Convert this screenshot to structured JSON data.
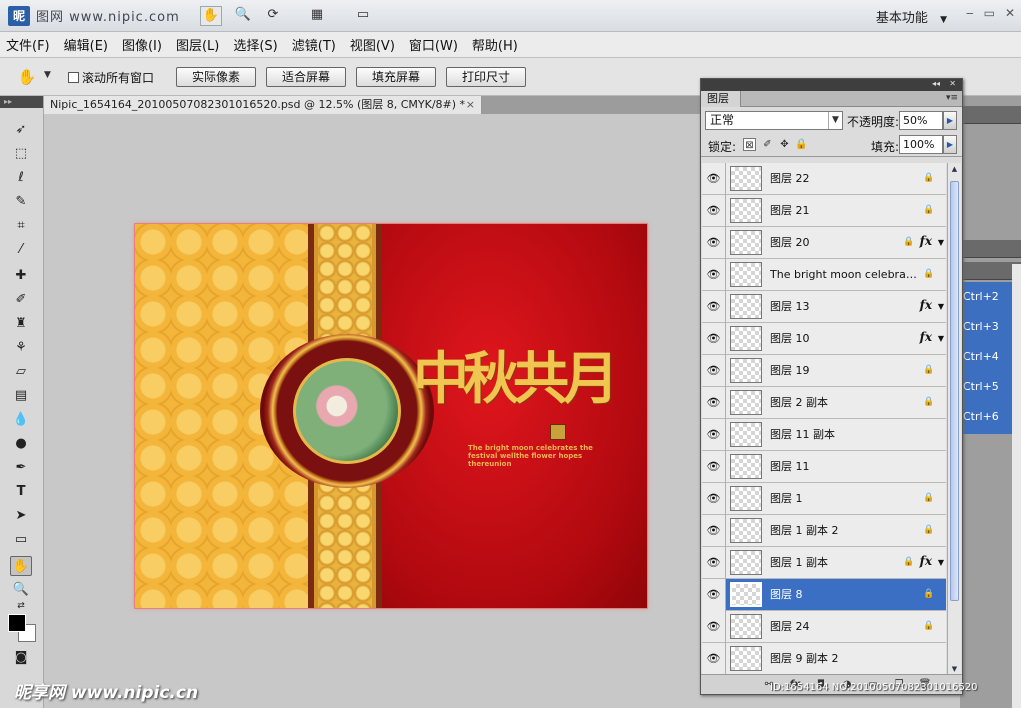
{
  "app": {
    "logo": "昵",
    "title_text": "图网  www.nipic.com",
    "workspace_label": "基本功能",
    "window_controls": [
      "‒",
      "▭",
      "✕"
    ]
  },
  "menu": [
    {
      "label": "文件(F)"
    },
    {
      "label": "编辑(E)"
    },
    {
      "label": "图像(I)"
    },
    {
      "label": "图层(L)"
    },
    {
      "label": "选择(S)"
    },
    {
      "label": "滤镜(T)"
    },
    {
      "label": "视图(V)"
    },
    {
      "label": "窗口(W)"
    },
    {
      "label": "帮助(H)"
    }
  ],
  "options": {
    "scroll_all_label": "滚动所有窗口",
    "buttons": [
      "实际像素",
      "适合屏幕",
      "填充屏幕",
      "打印尺寸"
    ]
  },
  "document": {
    "tab_title": "Nipic_1654164_20100507082301016520.psd @ 12.5% (图层 8, CMYK/8#) *",
    "close": "×"
  },
  "artwork": {
    "title_chars": "中秋共月",
    "caption": "The bright moon celebrates the festival wellthe flower hopes thereunion"
  },
  "layers_panel": {
    "tab_label": "图层",
    "blend_mode": "正常",
    "opacity_label": "不透明度:",
    "opacity_value": "50%",
    "lock_label": "锁定:",
    "fill_label": "填充:",
    "fill_value": "100%",
    "layers": [
      {
        "name": "图层 22",
        "locked": true,
        "fx": false,
        "selected": false
      },
      {
        "name": "图层 21",
        "locked": true,
        "fx": false,
        "selected": false
      },
      {
        "name": "图层 20",
        "locked": true,
        "fx": true,
        "selected": false
      },
      {
        "name": "The bright moon celebrates ...",
        "locked": true,
        "fx": false,
        "selected": false
      },
      {
        "name": "图层 13",
        "locked": false,
        "fx": true,
        "selected": false
      },
      {
        "name": "图层 10",
        "locked": false,
        "fx": true,
        "selected": false
      },
      {
        "name": "图层 19",
        "locked": true,
        "fx": false,
        "selected": false
      },
      {
        "name": "图层 2 副本",
        "locked": true,
        "fx": false,
        "selected": false
      },
      {
        "name": "图层 11 副本",
        "locked": false,
        "fx": false,
        "selected": false
      },
      {
        "name": "图层 11",
        "locked": false,
        "fx": false,
        "selected": false
      },
      {
        "name": "图层 1",
        "locked": true,
        "fx": false,
        "selected": false
      },
      {
        "name": "图层 1 副本 2",
        "locked": true,
        "fx": false,
        "selected": false
      },
      {
        "name": "图层 1 副本",
        "locked": true,
        "fx": true,
        "selected": false
      },
      {
        "name": "图层 8",
        "locked": true,
        "fx": false,
        "selected": true
      },
      {
        "name": "图层 24",
        "locked": true,
        "fx": false,
        "selected": false
      },
      {
        "name": "图层 9 副本 2",
        "locked": false,
        "fx": false,
        "selected": false
      }
    ]
  },
  "actions_panel": {
    "shortcuts": [
      "Ctrl+2",
      "Ctrl+3",
      "Ctrl+4",
      "Ctrl+5",
      "Ctrl+6"
    ]
  },
  "watermark": {
    "site": "昵享网 www.nipic.cn",
    "id_line": "ID:1654164 NO:20100507082301016520"
  },
  "colors": {
    "selection": "#3b6fc4",
    "art_red": "#c4100f",
    "art_gold": "#f3b53a"
  }
}
